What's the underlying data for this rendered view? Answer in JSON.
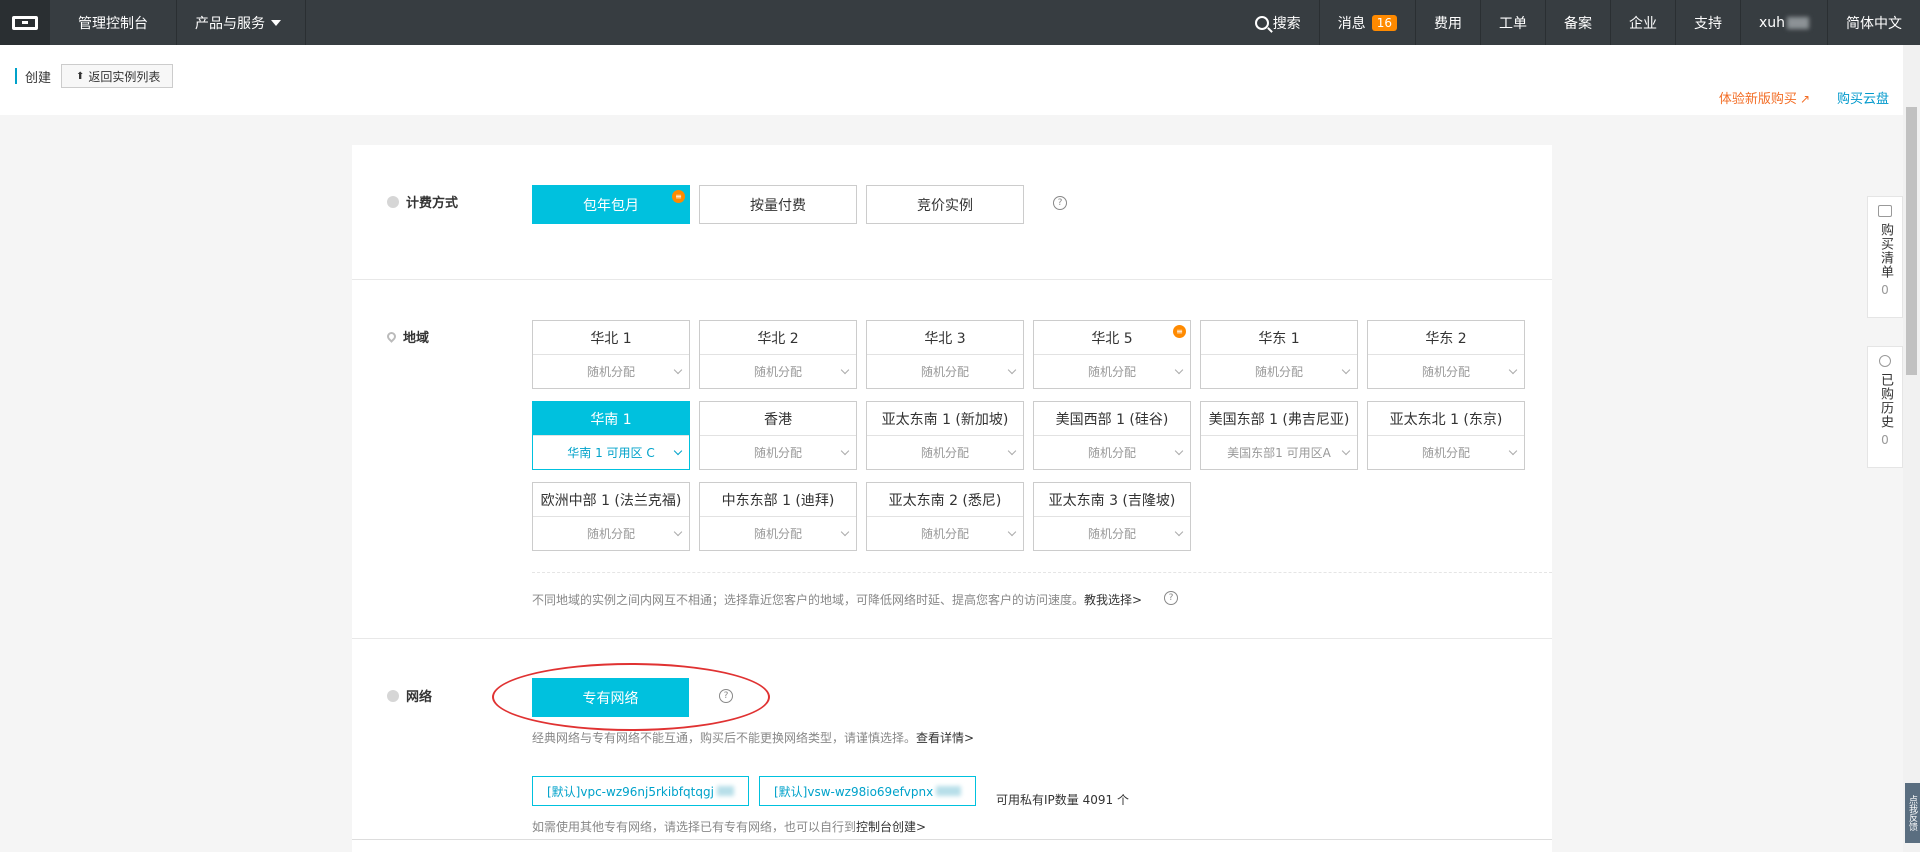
{
  "topbar": {
    "console": "管理控制台",
    "products": "产品与服务",
    "search": "搜索",
    "messages": "消息",
    "messages_count": "16",
    "billing": "费用",
    "tickets": "工单",
    "icp": "备案",
    "enterprise": "企业",
    "support": "支持",
    "user": "xuh",
    "language": "简体中文"
  },
  "subheader": {
    "title": "创建",
    "back": "返回实例列表",
    "try_new": "体验新版购买",
    "buy_disk": "购买云盘"
  },
  "billing": {
    "label": "计费方式",
    "options": [
      "包年包月",
      "按量付费",
      "竞价实例"
    ],
    "selected": "包年包月",
    "help": "?"
  },
  "region": {
    "label": "地域",
    "rows": [
      [
        {
          "name": "华北 1",
          "zone": "随机分配"
        },
        {
          "name": "华北 2",
          "zone": "随机分配"
        },
        {
          "name": "华北 3",
          "zone": "随机分配"
        },
        {
          "name": "华北 5",
          "zone": "随机分配"
        },
        {
          "name": "华东 1",
          "zone": "随机分配"
        },
        {
          "name": "华东 2",
          "zone": "随机分配"
        }
      ],
      [
        {
          "name": "华南 1",
          "zone": "华南 1 可用区 C"
        },
        {
          "name": "香港",
          "zone": "随机分配"
        },
        {
          "name": "亚太东南 1 (新加坡)",
          "zone": "随机分配"
        },
        {
          "name": "美国西部 1 (硅谷)",
          "zone": "随机分配"
        },
        {
          "name": "美国东部 1 (弗吉尼亚)",
          "zone": "美国东部1 可用区A"
        },
        {
          "name": "亚太东北 1 (东京)",
          "zone": "随机分配"
        }
      ],
      [
        {
          "name": "欧洲中部 1 (法兰克福)",
          "zone": "随机分配"
        },
        {
          "name": "中东东部 1 (迪拜)",
          "zone": "随机分配"
        },
        {
          "name": "亚太东南 2 (悉尼)",
          "zone": "随机分配"
        },
        {
          "name": "亚太东南 3 (吉隆坡)",
          "zone": "随机分配"
        }
      ]
    ],
    "selected": "华南 1",
    "hint": "不同地域的实例之间内网互不相通；选择靠近您客户的地域，可降低网络时延、提高您客户的访问速度。",
    "hint_link": "教我选择>",
    "help": "?"
  },
  "network": {
    "label": "网络",
    "option": "专有网络",
    "help": "?",
    "hint": "经典网络与专有网络不能互通，购买后不能更换网络类型，请谨慎选择。",
    "hint_link": "查看详情>",
    "vpc": "[默认]vpc-wz96nj5rkibfqtqgj",
    "vswitch": "[默认]vsw-wz98io69efvpnx",
    "ip_count": "可用私有IP数量 4091 个",
    "footer_hint": "如需使用其他专有网络，请选择已有专有网络，也可以自行到",
    "footer_link": "控制台创建>"
  },
  "sidebar_float": {
    "cart": "购买清单",
    "cart_count": "0",
    "history": "已购历史",
    "history_count": "0"
  },
  "feedback": "点我反馈",
  "colors": {
    "accent": "#00c1de",
    "topbar": "#373d41",
    "badge": "#ff8a00",
    "link_orange": "#f36d25",
    "annotation_red": "#e03232"
  }
}
